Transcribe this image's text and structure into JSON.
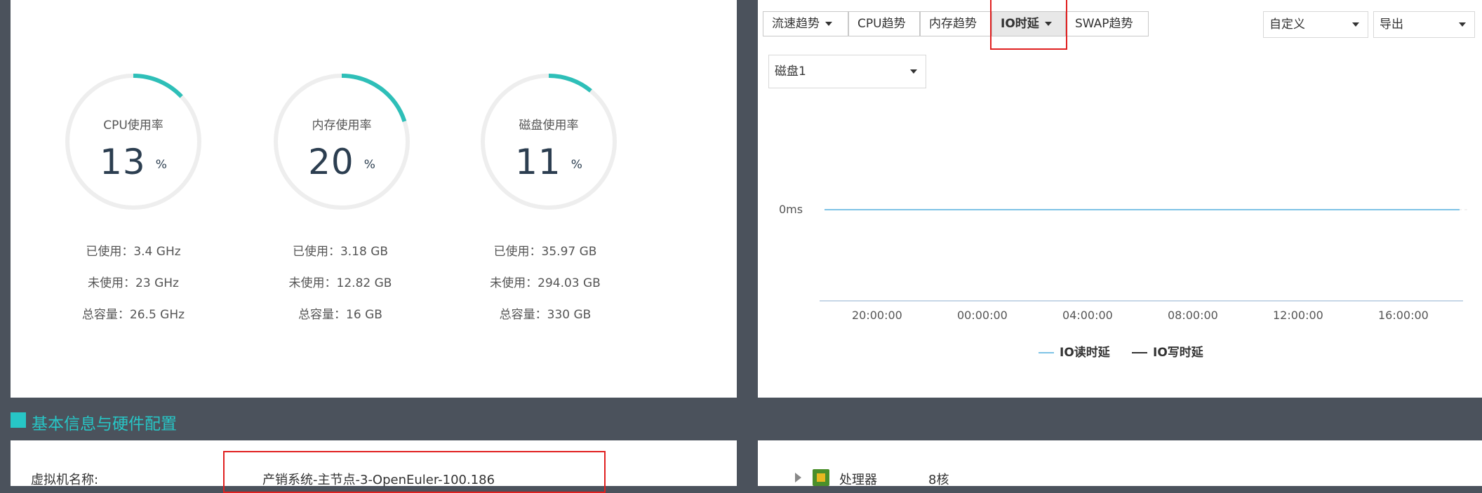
{
  "gauges": [
    {
      "title": "CPU使用率",
      "value": "13",
      "unit": "%",
      "percent": 13,
      "used": "已使用：3.4 GHz",
      "unused": "未使用：23 GHz",
      "total": "总容量：26.5 GHz"
    },
    {
      "title": "内存使用率",
      "value": "20",
      "unit": "%",
      "percent": 20,
      "used": "已使用：3.18 GB",
      "unused": "未使用：12.82 GB",
      "total": "总容量：16 GB"
    },
    {
      "title": "磁盘使用率",
      "value": "11",
      "unit": "%",
      "percent": 11,
      "used": "已使用：35.97 GB",
      "unused": "未使用：294.03 GB",
      "total": "总容量：330 GB"
    }
  ],
  "toolbar": {
    "tabs": [
      "流速趋势",
      "CPU趋势",
      "内存趋势",
      "IO时延",
      "SWAP趋势"
    ],
    "active_tab": "IO时延",
    "range_select": "自定义",
    "export_select": "导出",
    "disk_select": "磁盘1"
  },
  "chart_data": {
    "type": "line",
    "y_tick": "0ms",
    "x_ticks": [
      "20:00:00",
      "00:00:00",
      "04:00:00",
      "08:00:00",
      "12:00:00",
      "16:00:00"
    ],
    "series": [
      {
        "name": "IO读时延",
        "color": "#7ec3e6",
        "values": [
          0,
          0
        ]
      },
      {
        "name": "IO写时延",
        "color": "#333333",
        "values": [
          0,
          0
        ]
      }
    ]
  },
  "section": {
    "title": "基本信息与硬件配置"
  },
  "basic_info": {
    "vm_name_label": "虚拟机名称:",
    "vm_name_value": "产销系统-主节点-3-OpenEuler-100.186"
  },
  "hardware": {
    "processor_label": "处理器",
    "processor_value": "8核"
  },
  "colors": {
    "accent": "#27c6c6",
    "highlight": "#e02020",
    "background": "#4b525c"
  }
}
